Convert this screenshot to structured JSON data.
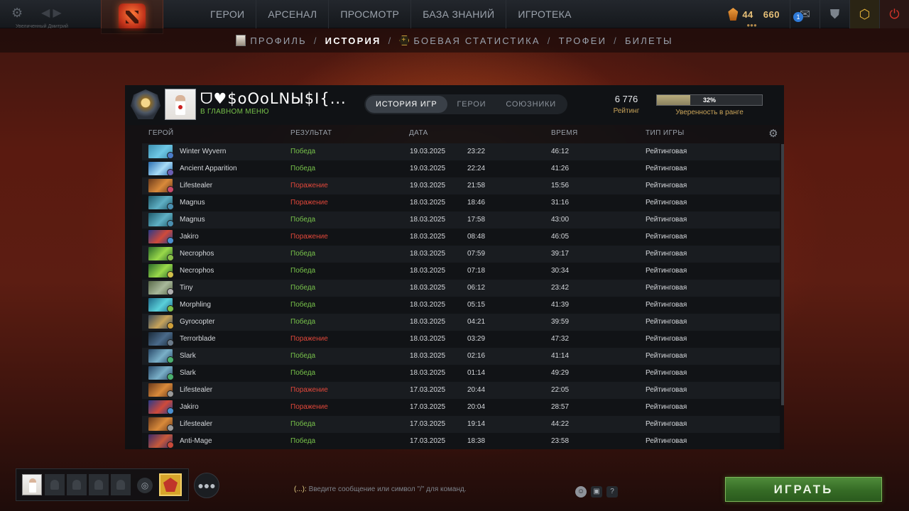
{
  "topbar": {
    "user_tag": "Увеличенный Дмитрий",
    "nav": [
      "ГЕРОИ",
      "АРСЕНАЛ",
      "ПРОСМОТР",
      "БАЗА ЗНАНИЙ",
      "ИГРОТЕКА"
    ],
    "currency_shards": "44",
    "currency_main": "660",
    "notification_count": "1"
  },
  "subnav": {
    "items": [
      "ПРОФИЛЬ",
      "ИСТОРИЯ",
      "БОЕВАЯ СТАТИСТИКА",
      "ТРОФЕИ",
      "БИЛЕТЫ"
    ],
    "separator": "/",
    "active_index": 1
  },
  "profile": {
    "name": "ᗜ♥$oOoLNЫ$I{...",
    "status": "В ГЛАВНОМ МЕНЮ",
    "tabs": [
      "ИСТОРИЯ ИГР",
      "ГЕРОИ",
      "СОЮЗНИКИ"
    ],
    "rating_value": "6 776",
    "rating_label": "Рейтинг",
    "confidence_text": "32%",
    "confidence_fraction": 0.32,
    "confidence_label": "Уверенность в ранге"
  },
  "table": {
    "headers": {
      "hero": "ГЕРОЙ",
      "result": "РЕЗУЛЬТАТ",
      "date": "ДАТА",
      "duration": "ВРЕМЯ",
      "mode": "ТИП ИГРЫ"
    },
    "rows": [
      {
        "hero": "Winter Wyvern",
        "result": "Победа",
        "win": true,
        "date": "19.03.2025",
        "time": "23:22",
        "duration": "46:12",
        "mode": "Рейтинговая",
        "c1": "#3c8fb0",
        "c2": "#6fc8e6",
        "badge": "#4a7cc9"
      },
      {
        "hero": "Ancient Apparition",
        "result": "Победа",
        "win": true,
        "date": "19.03.2025",
        "time": "22:24",
        "duration": "41:26",
        "mode": "Рейтинговая",
        "c1": "#2c6fb0",
        "c2": "#a8dcf7",
        "badge": "#6a5fb5"
      },
      {
        "hero": "Lifestealer",
        "result": "Поражение",
        "win": false,
        "date": "19.03.2025",
        "time": "21:58",
        "duration": "15:56",
        "mode": "Рейтинговая",
        "c1": "#6b3a1c",
        "c2": "#d98a3a",
        "badge": "#c94a6a"
      },
      {
        "hero": "Magnus",
        "result": "Поражение",
        "win": false,
        "date": "18.03.2025",
        "time": "18:46",
        "duration": "31:16",
        "mode": "Рейтинговая",
        "c1": "#1f5a6b",
        "c2": "#5fb0c4",
        "badge": "#4a8fb0"
      },
      {
        "hero": "Magnus",
        "result": "Победа",
        "win": true,
        "date": "18.03.2025",
        "time": "17:58",
        "duration": "43:00",
        "mode": "Рейтинговая",
        "c1": "#1f5a6b",
        "c2": "#5fb0c4",
        "badge": "#4a8fb0"
      },
      {
        "hero": "Jakiro",
        "result": "Поражение",
        "win": false,
        "date": "18.03.2025",
        "time": "08:48",
        "duration": "46:05",
        "mode": "Рейтинговая",
        "c1": "#2a3a8a",
        "c2": "#d04a3a",
        "badge": "#4a8fd0"
      },
      {
        "hero": "Necrophos",
        "result": "Победа",
        "win": true,
        "date": "18.03.2025",
        "time": "07:59",
        "duration": "39:17",
        "mode": "Рейтинговая",
        "c1": "#2a6a2a",
        "c2": "#9ad94a",
        "badge": "#8ac04a"
      },
      {
        "hero": "Necrophos",
        "result": "Победа",
        "win": true,
        "date": "18.03.2025",
        "time": "07:18",
        "duration": "30:34",
        "mode": "Рейтинговая",
        "c1": "#2a6a2a",
        "c2": "#9ad94a",
        "badge": "#d0c04a"
      },
      {
        "hero": "Tiny",
        "result": "Победа",
        "win": true,
        "date": "18.03.2025",
        "time": "06:12",
        "duration": "23:42",
        "mode": "Рейтинговая",
        "c1": "#5a6a4a",
        "c2": "#a8b89a",
        "badge": "#b0b0b0"
      },
      {
        "hero": "Morphling",
        "result": "Победа",
        "win": true,
        "date": "18.03.2025",
        "time": "05:15",
        "duration": "41:39",
        "mode": "Рейтинговая",
        "c1": "#1f6a8a",
        "c2": "#5ad0d9",
        "badge": "#7ac04a"
      },
      {
        "hero": "Gyrocopter",
        "result": "Победа",
        "win": true,
        "date": "18.03.2025",
        "time": "04:21",
        "duration": "39:59",
        "mode": "Рейтинговая",
        "c1": "#3a4a5a",
        "c2": "#c8a45a",
        "badge": "#d0a03a"
      },
      {
        "hero": "Terrorblade",
        "result": "Поражение",
        "win": false,
        "date": "18.03.2025",
        "time": "03:29",
        "duration": "47:32",
        "mode": "Рейтинговая",
        "c1": "#1a2a3a",
        "c2": "#4a6a8a",
        "badge": "#6a7a8a"
      },
      {
        "hero": "Slark",
        "result": "Победа",
        "win": true,
        "date": "18.03.2025",
        "time": "02:16",
        "duration": "41:14",
        "mode": "Рейтинговая",
        "c1": "#2a4a6a",
        "c2": "#7ab0c8",
        "badge": "#4ab070"
      },
      {
        "hero": "Slark",
        "result": "Победа",
        "win": true,
        "date": "18.03.2025",
        "time": "01:14",
        "duration": "49:29",
        "mode": "Рейтинговая",
        "c1": "#2a4a6a",
        "c2": "#7ab0c8",
        "badge": "#4ab070"
      },
      {
        "hero": "Lifestealer",
        "result": "Поражение",
        "win": false,
        "date": "17.03.2025",
        "time": "20:44",
        "duration": "22:05",
        "mode": "Рейтинговая",
        "c1": "#6b3a1c",
        "c2": "#d98a3a",
        "badge": "#9a9a9a"
      },
      {
        "hero": "Jakiro",
        "result": "Поражение",
        "win": false,
        "date": "17.03.2025",
        "time": "20:04",
        "duration": "28:57",
        "mode": "Рейтинговая",
        "c1": "#2a3a8a",
        "c2": "#d04a3a",
        "badge": "#4a8fd0"
      },
      {
        "hero": "Lifestealer",
        "result": "Победа",
        "win": true,
        "date": "17.03.2025",
        "time": "19:14",
        "duration": "44:22",
        "mode": "Рейтинговая",
        "c1": "#6b3a1c",
        "c2": "#d98a3a",
        "badge": "#9a9a9a"
      },
      {
        "hero": "Anti-Mage",
        "result": "Победа",
        "win": true,
        "date": "17.03.2025",
        "time": "18:38",
        "duration": "23:58",
        "mode": "Рейтинговая",
        "c1": "#3a2a6a",
        "c2": "#c85a3a",
        "badge": "#c84a3a"
      }
    ]
  },
  "bottom": {
    "chat_prefix": "(...):",
    "chat_placeholder": "Введите сообщение или символ \"/\" для команд.",
    "help_label": "?",
    "play_label": "ИГРАТЬ"
  },
  "colors": {
    "win": "#77c14a",
    "loss": "#e0473a",
    "accent_gold": "#c9a45a",
    "play_green": "#356b25"
  }
}
